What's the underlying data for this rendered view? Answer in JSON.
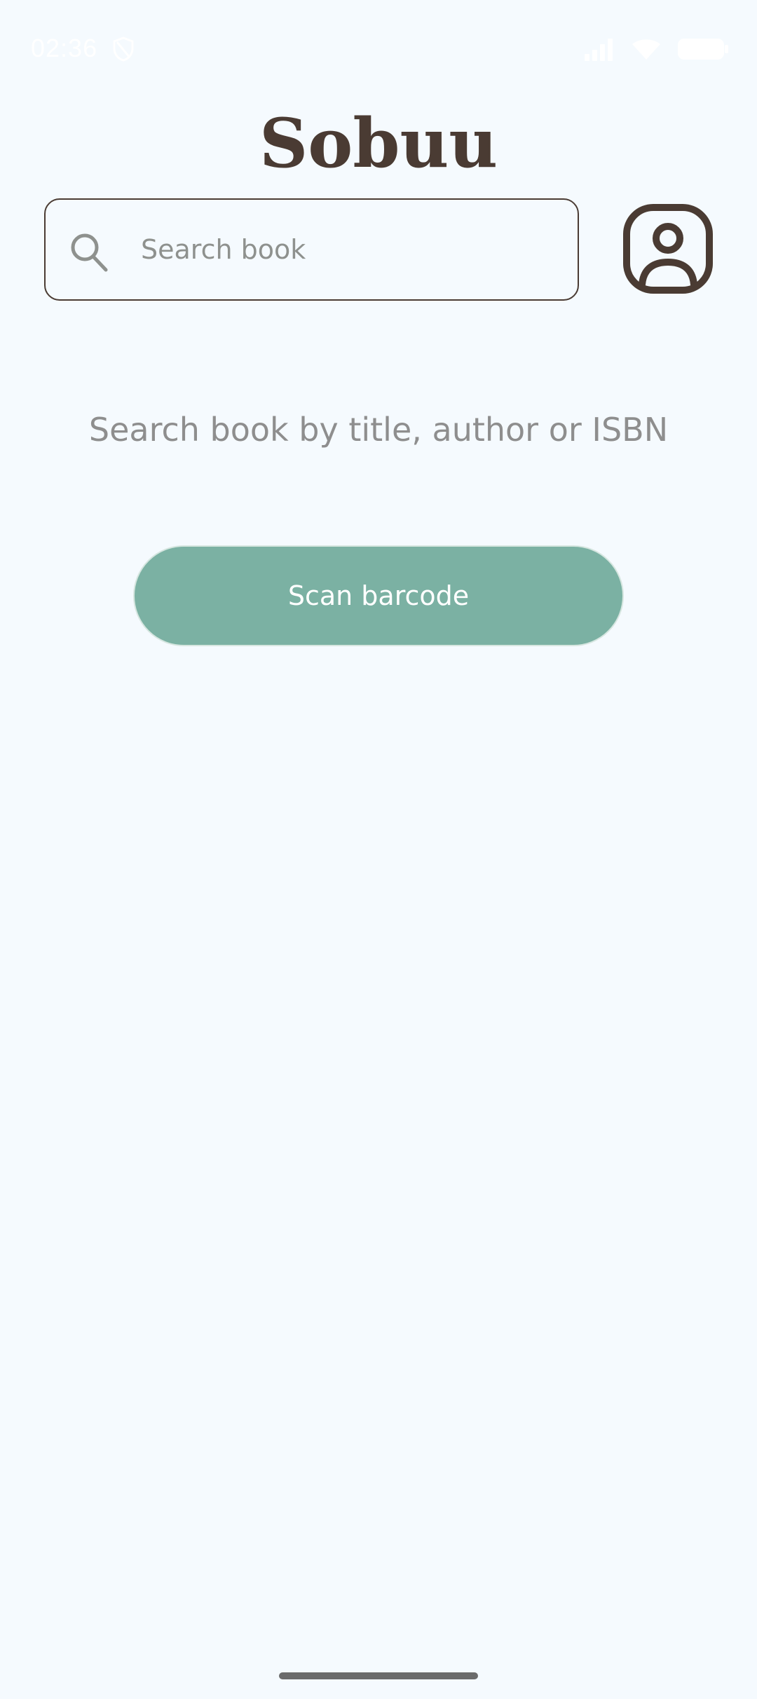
{
  "status_bar": {
    "time": "02:36",
    "icons": [
      "shield-icon",
      "signal-icon",
      "wifi-icon",
      "battery-icon"
    ]
  },
  "header": {
    "title": "Sobuu"
  },
  "search": {
    "placeholder": "Search book",
    "value": ""
  },
  "profile": {
    "icon": "user-profile-icon"
  },
  "main": {
    "hint": "Search book by title, author or ISBN",
    "scan_label": "Scan barcode"
  },
  "colors": {
    "background": "#F5FAFE",
    "text_dark": "#4A3B33",
    "accent": "#7BB1A3",
    "placeholder": "#8E918E"
  }
}
